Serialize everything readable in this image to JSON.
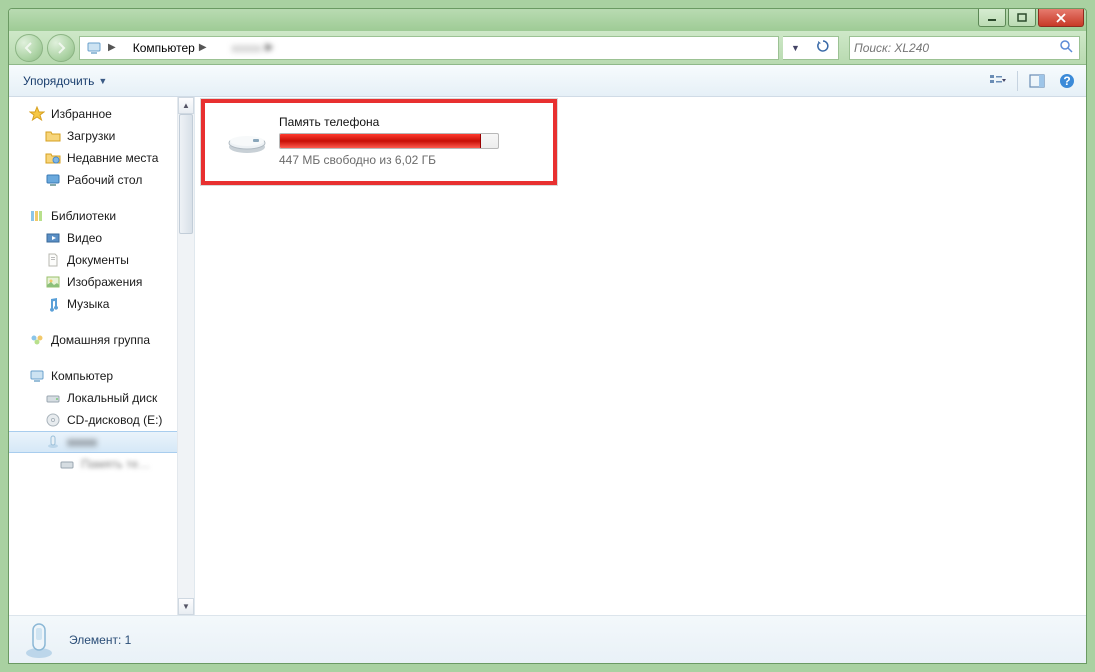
{
  "breadcrumb": {
    "root": "Компьютер"
  },
  "search": {
    "placeholder": "Поиск: XL240"
  },
  "toolbar": {
    "organize": "Упорядочить"
  },
  "sidebar": {
    "favorites": {
      "label": "Избранное",
      "items": [
        "Загрузки",
        "Недавние места",
        "Рабочий стол"
      ]
    },
    "libraries": {
      "label": "Библиотеки",
      "items": [
        "Видео",
        "Документы",
        "Изображения",
        "Музыка"
      ]
    },
    "homegroup": {
      "label": "Домашняя группа"
    },
    "computer": {
      "label": "Компьютер",
      "items": [
        "Локальный диск",
        "CD-дисковод (E:)"
      ]
    }
  },
  "drive": {
    "name": "Память телефона",
    "stats": "447 МБ свободно из 6,02 ГБ",
    "fill_percent": 92
  },
  "statusbar": {
    "text": "Элемент: 1"
  }
}
